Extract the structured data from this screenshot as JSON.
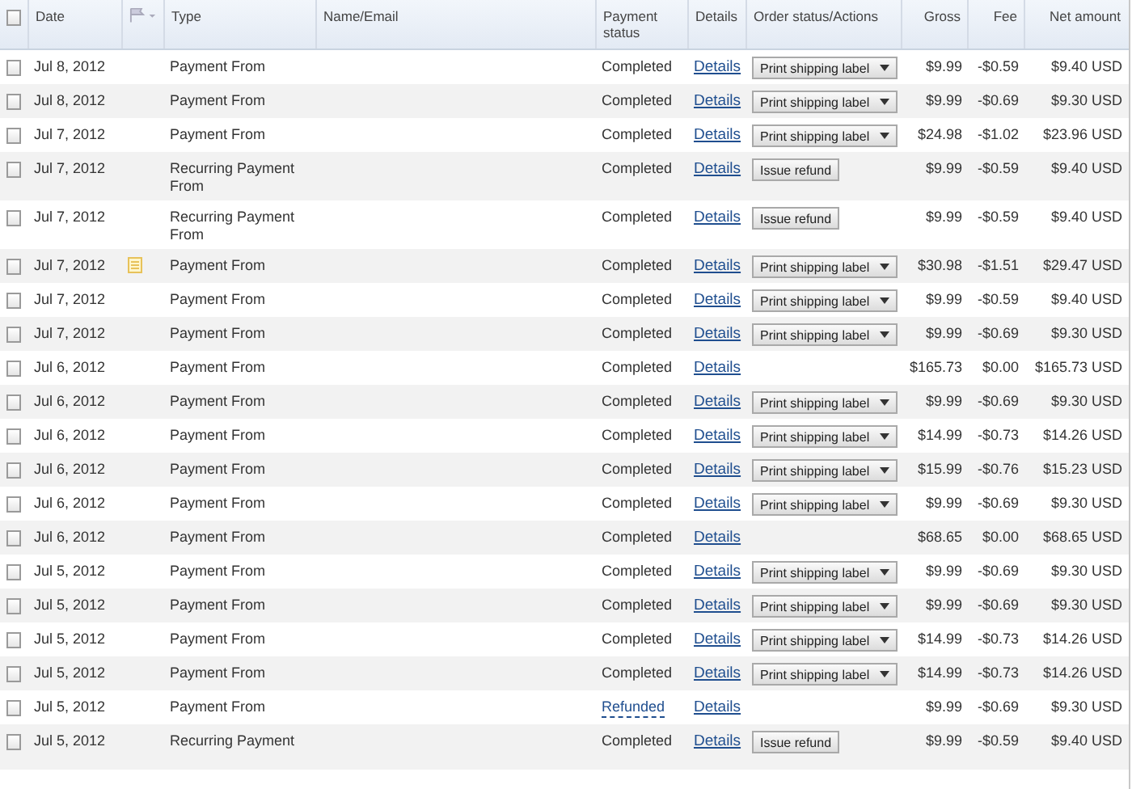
{
  "table": {
    "select_all": {
      "checked": false
    },
    "columns": [
      "Date",
      "Type",
      "Name/Email",
      "Payment status",
      "Details",
      "Order status/Actions",
      "Gross",
      "Fee",
      "Net amount"
    ],
    "rows": [
      {
        "checked": false,
        "date": "Jul 8, 2012",
        "note": false,
        "type": "Payment From",
        "status": "Completed",
        "refunded": false,
        "details": "Details",
        "action": {
          "kind": "select",
          "label": "Print shipping label"
        },
        "gross": "$9.99",
        "fee": "-$0.59",
        "net": "$9.40 USD"
      },
      {
        "checked": false,
        "date": "Jul 8, 2012",
        "note": false,
        "type": "Payment From",
        "status": "Completed",
        "refunded": false,
        "details": "Details",
        "action": {
          "kind": "select",
          "label": "Print shipping label"
        },
        "gross": "$9.99",
        "fee": "-$0.69",
        "net": "$9.30 USD"
      },
      {
        "checked": false,
        "date": "Jul 7, 2012",
        "note": false,
        "type": "Payment From",
        "status": "Completed",
        "refunded": false,
        "details": "Details",
        "action": {
          "kind": "select",
          "label": "Print shipping label"
        },
        "gross": "$24.98",
        "fee": "-$1.02",
        "net": "$23.96 USD"
      },
      {
        "checked": false,
        "date": "Jul 7, 2012",
        "note": false,
        "type": "Recurring Payment From",
        "status": "Completed",
        "refunded": false,
        "details": "Details",
        "action": {
          "kind": "button",
          "label": "Issue refund"
        },
        "gross": "$9.99",
        "fee": "-$0.59",
        "net": "$9.40 USD"
      },
      {
        "checked": false,
        "date": "Jul 7, 2012",
        "note": false,
        "type": "Recurring Payment From",
        "status": "Completed",
        "refunded": false,
        "details": "Details",
        "action": {
          "kind": "button",
          "label": "Issue refund"
        },
        "gross": "$9.99",
        "fee": "-$0.59",
        "net": "$9.40 USD"
      },
      {
        "checked": false,
        "date": "Jul 7, 2012",
        "note": true,
        "type": "Payment From",
        "status": "Completed",
        "refunded": false,
        "details": "Details",
        "action": {
          "kind": "select",
          "label": "Print shipping label"
        },
        "gross": "$30.98",
        "fee": "-$1.51",
        "net": "$29.47 USD"
      },
      {
        "checked": false,
        "date": "Jul 7, 2012",
        "note": false,
        "type": "Payment From",
        "status": "Completed",
        "refunded": false,
        "details": "Details",
        "action": {
          "kind": "select",
          "label": "Print shipping label"
        },
        "gross": "$9.99",
        "fee": "-$0.59",
        "net": "$9.40 USD"
      },
      {
        "checked": false,
        "date": "Jul 7, 2012",
        "note": false,
        "type": "Payment From",
        "status": "Completed",
        "refunded": false,
        "details": "Details",
        "action": {
          "kind": "select",
          "label": "Print shipping label"
        },
        "gross": "$9.99",
        "fee": "-$0.69",
        "net": "$9.30 USD"
      },
      {
        "checked": false,
        "date": "Jul 6, 2012",
        "note": false,
        "type": "Payment From",
        "status": "Completed",
        "refunded": false,
        "details": "Details",
        "action": {
          "kind": "none"
        },
        "gross": "$165.73",
        "fee": "$0.00",
        "net": "$165.73 USD"
      },
      {
        "checked": false,
        "date": "Jul 6, 2012",
        "note": false,
        "type": "Payment From",
        "status": "Completed",
        "refunded": false,
        "details": "Details",
        "action": {
          "kind": "select",
          "label": "Print shipping label"
        },
        "gross": "$9.99",
        "fee": "-$0.69",
        "net": "$9.30 USD"
      },
      {
        "checked": false,
        "date": "Jul 6, 2012",
        "note": false,
        "type": "Payment From",
        "status": "Completed",
        "refunded": false,
        "details": "Details",
        "action": {
          "kind": "select",
          "label": "Print shipping label"
        },
        "gross": "$14.99",
        "fee": "-$0.73",
        "net": "$14.26 USD"
      },
      {
        "checked": false,
        "date": "Jul 6, 2012",
        "note": false,
        "type": "Payment From",
        "status": "Completed",
        "refunded": false,
        "details": "Details",
        "action": {
          "kind": "select",
          "label": "Print shipping label"
        },
        "gross": "$15.99",
        "fee": "-$0.76",
        "net": "$15.23 USD"
      },
      {
        "checked": false,
        "date": "Jul 6, 2012",
        "note": false,
        "type": "Payment From",
        "status": "Completed",
        "refunded": false,
        "details": "Details",
        "action": {
          "kind": "select",
          "label": "Print shipping label"
        },
        "gross": "$9.99",
        "fee": "-$0.69",
        "net": "$9.30 USD"
      },
      {
        "checked": false,
        "date": "Jul 6, 2012",
        "note": false,
        "type": "Payment From",
        "status": "Completed",
        "refunded": false,
        "details": "Details",
        "action": {
          "kind": "none"
        },
        "gross": "$68.65",
        "fee": "$0.00",
        "net": "$68.65 USD"
      },
      {
        "checked": false,
        "date": "Jul 5, 2012",
        "note": false,
        "type": "Payment From",
        "status": "Completed",
        "refunded": false,
        "details": "Details",
        "action": {
          "kind": "select",
          "label": "Print shipping label"
        },
        "gross": "$9.99",
        "fee": "-$0.69",
        "net": "$9.30 USD"
      },
      {
        "checked": false,
        "date": "Jul 5, 2012",
        "note": false,
        "type": "Payment From",
        "status": "Completed",
        "refunded": false,
        "details": "Details",
        "action": {
          "kind": "select",
          "label": "Print shipping label"
        },
        "gross": "$9.99",
        "fee": "-$0.69",
        "net": "$9.30 USD"
      },
      {
        "checked": false,
        "date": "Jul 5, 2012",
        "note": false,
        "type": "Payment From",
        "status": "Completed",
        "refunded": false,
        "details": "Details",
        "action": {
          "kind": "select",
          "label": "Print shipping label"
        },
        "gross": "$14.99",
        "fee": "-$0.73",
        "net": "$14.26 USD"
      },
      {
        "checked": false,
        "date": "Jul 5, 2012",
        "note": false,
        "type": "Payment From",
        "status": "Completed",
        "refunded": false,
        "details": "Details",
        "action": {
          "kind": "select",
          "label": "Print shipping label"
        },
        "gross": "$14.99",
        "fee": "-$0.73",
        "net": "$14.26 USD"
      },
      {
        "checked": false,
        "date": "Jul 5, 2012",
        "note": false,
        "type": "Payment From",
        "status": "Refunded",
        "refunded": true,
        "details": "Details",
        "action": {
          "kind": "none"
        },
        "gross": "$9.99",
        "fee": "-$0.69",
        "net": "$9.30 USD"
      },
      {
        "checked": false,
        "date": "Jul 5, 2012",
        "note": false,
        "type": "Recurring Payment",
        "status": "Completed",
        "refunded": false,
        "details": "Details",
        "action": {
          "kind": "button",
          "label": "Issue refund"
        },
        "gross": "$9.99",
        "fee": "-$0.59",
        "net": "$9.40 USD"
      }
    ]
  }
}
